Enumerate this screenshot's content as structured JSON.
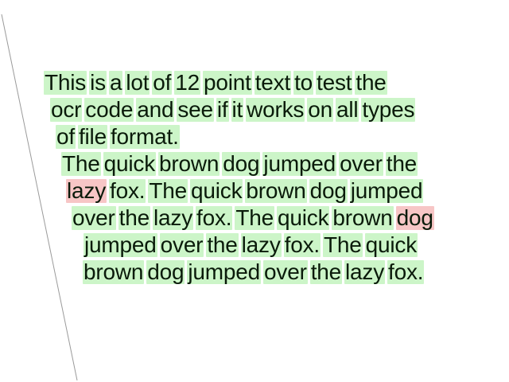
{
  "colors": {
    "recognized_highlight": "#ccf5c8",
    "unrecognized_highlight": "#f7c6c6",
    "text": "#0a1a0a"
  },
  "lines": [
    {
      "words": [
        {
          "t": "This",
          "s": "ok"
        },
        {
          "t": "is",
          "s": "ok"
        },
        {
          "t": "a",
          "s": "ok"
        },
        {
          "t": "lot",
          "s": "ok"
        },
        {
          "t": "of",
          "s": "ok"
        },
        {
          "t": "12",
          "s": "ok"
        },
        {
          "t": "point",
          "s": "ok"
        },
        {
          "t": "text",
          "s": "ok"
        },
        {
          "t": "to",
          "s": "ok"
        },
        {
          "t": "test",
          "s": "ok"
        },
        {
          "t": "the",
          "s": "ok"
        }
      ]
    },
    {
      "words": [
        {
          "t": "ocr",
          "s": "ok"
        },
        {
          "t": "code",
          "s": "ok"
        },
        {
          "t": "and",
          "s": "ok"
        },
        {
          "t": "see",
          "s": "ok"
        },
        {
          "t": "if",
          "s": "ok"
        },
        {
          "t": "it",
          "s": "ok"
        },
        {
          "t": "works",
          "s": "ok"
        },
        {
          "t": "on",
          "s": "ok"
        },
        {
          "t": "all",
          "s": "ok"
        },
        {
          "t": "types",
          "s": "ok"
        }
      ]
    },
    {
      "words": [
        {
          "t": "of",
          "s": "ok"
        },
        {
          "t": "file",
          "s": "ok"
        },
        {
          "t": "format.",
          "s": "ok"
        }
      ]
    },
    {
      "words": [
        {
          "t": "The",
          "s": "ok"
        },
        {
          "t": "quick",
          "s": "ok"
        },
        {
          "t": "brown",
          "s": "ok"
        },
        {
          "t": "dog",
          "s": "ok"
        },
        {
          "t": "jumped",
          "s": "ok"
        },
        {
          "t": "over",
          "s": "ok"
        },
        {
          "t": "the",
          "s": "ok"
        }
      ]
    },
    {
      "words": [
        {
          "t": "lazy",
          "s": "bad"
        },
        {
          "t": "fox.",
          "s": "ok"
        },
        {
          "t": "The",
          "s": "ok"
        },
        {
          "t": "quick",
          "s": "ok"
        },
        {
          "t": "brown",
          "s": "ok"
        },
        {
          "t": "dog",
          "s": "ok"
        },
        {
          "t": "jumped",
          "s": "ok"
        }
      ]
    },
    {
      "words": [
        {
          "t": "over",
          "s": "ok"
        },
        {
          "t": "the",
          "s": "ok"
        },
        {
          "t": "lazy",
          "s": "ok"
        },
        {
          "t": "fox.",
          "s": "ok"
        },
        {
          "t": "The",
          "s": "ok"
        },
        {
          "t": "quick",
          "s": "ok"
        },
        {
          "t": "brown",
          "s": "ok"
        },
        {
          "t": "dog",
          "s": "bad"
        }
      ]
    },
    {
      "words": [
        {
          "t": "jumped",
          "s": "ok"
        },
        {
          "t": "over",
          "s": "ok"
        },
        {
          "t": "the",
          "s": "ok"
        },
        {
          "t": "lazy",
          "s": "ok"
        },
        {
          "t": "fox.",
          "s": "ok"
        },
        {
          "t": "The",
          "s": "ok"
        },
        {
          "t": "quick",
          "s": "ok"
        }
      ]
    },
    {
      "words": [
        {
          "t": "brown",
          "s": "ok"
        },
        {
          "t": "dog",
          "s": "ok"
        },
        {
          "t": "jumped",
          "s": "ok"
        },
        {
          "t": "over",
          "s": "ok"
        },
        {
          "t": "the",
          "s": "ok"
        },
        {
          "t": "lazy",
          "s": "ok"
        },
        {
          "t": "fox.",
          "s": "ok"
        }
      ]
    }
  ]
}
